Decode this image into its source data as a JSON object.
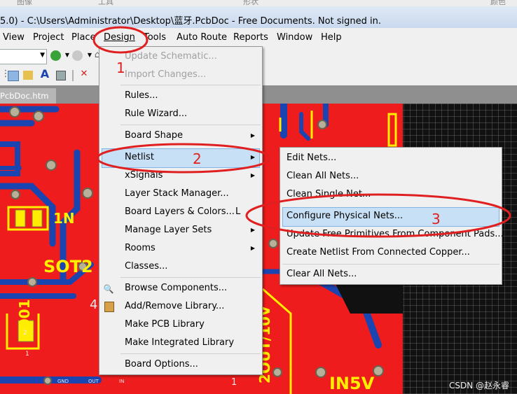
{
  "topstrip": [
    "图像",
    "工具",
    "形状",
    "颜色"
  ],
  "window": {
    "title": "5.0) - C:\\Users\\Administrator\\Desktop\\蓝牙.PcbDoc - Free Documents. Not signed in."
  },
  "menubar": [
    "View",
    "Project",
    "Place",
    "Design",
    "Tools",
    "Auto Route",
    "Reports",
    "Window",
    "Help"
  ],
  "document_tab": "PcbDoc.htm",
  "design_menu": {
    "items": [
      {
        "label": "Update Schematic...",
        "enabled": false
      },
      {
        "label": "Import Changes...",
        "enabled": false
      },
      {
        "label": "Rules...",
        "enabled": true
      },
      {
        "label": "Rule Wizard...",
        "enabled": true
      },
      {
        "label": "Board Shape",
        "enabled": true,
        "submenu": true
      },
      {
        "label": "Netlist",
        "enabled": true,
        "submenu": true,
        "highlighted": true
      },
      {
        "label": "xSignals",
        "enabled": true,
        "submenu": true
      },
      {
        "label": "Layer Stack Manager...",
        "enabled": true
      },
      {
        "label": "Board Layers & Colors...",
        "enabled": true,
        "shortcut": "L"
      },
      {
        "label": "Manage Layer Sets",
        "enabled": true,
        "submenu": true
      },
      {
        "label": "Rooms",
        "enabled": true,
        "submenu": true
      },
      {
        "label": "Classes...",
        "enabled": true
      },
      {
        "label": "Browse Components...",
        "enabled": true,
        "icon": "browse-components-icon"
      },
      {
        "label": "Add/Remove Library...",
        "enabled": true,
        "icon": "library-icon"
      },
      {
        "label": "Make PCB Library",
        "enabled": true
      },
      {
        "label": "Make Integrated Library",
        "enabled": true
      },
      {
        "label": "Board Options...",
        "enabled": true
      }
    ]
  },
  "netlist_submenu": {
    "items": [
      {
        "label": "Edit Nets..."
      },
      {
        "label": "Clean All Nets..."
      },
      {
        "label": "Clean Single Net..."
      },
      {
        "label": "Configure Physical Nets...",
        "highlighted": true
      },
      {
        "label": "Update Free Primitives From Component Pads..."
      },
      {
        "label": "Create Netlist From Connected Copper..."
      },
      {
        "label": "Clear All Nets..."
      }
    ]
  },
  "annotations": {
    "step1": "1",
    "step2": "2",
    "step3": "3",
    "color": "#e02020"
  },
  "pcb_labels": [
    "1N",
    "SOT2",
    "4",
    "N001",
    "IN5V",
    "1",
    "2",
    "1",
    "2OUT/10V",
    "GND",
    "OUT",
    "IN"
  ],
  "watermark": "CSDN @赵永睿",
  "colors": {
    "board": "#ee1c1c",
    "trace": "#1a44b0",
    "silkscreen": "#ffee00",
    "highlight": "#c7e0f5"
  }
}
